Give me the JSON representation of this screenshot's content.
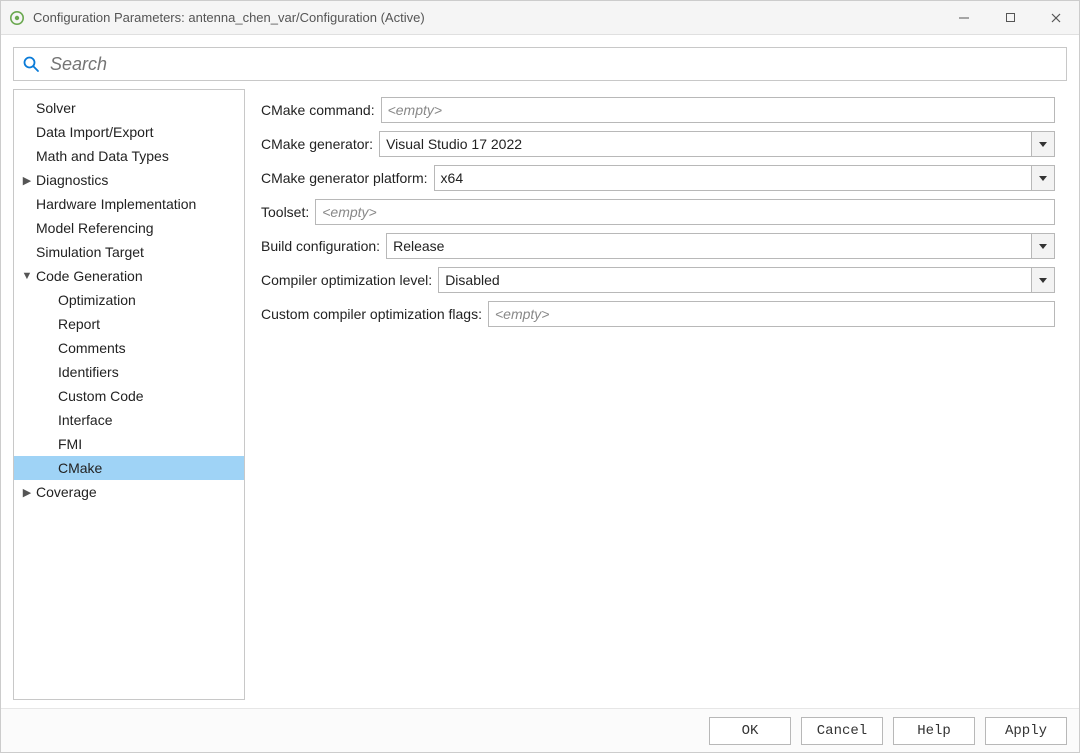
{
  "window": {
    "title": "Configuration Parameters: antenna_chen_var/Configuration (Active)"
  },
  "search": {
    "placeholder": "Search"
  },
  "sidebar": {
    "items": [
      {
        "label": "Solver",
        "depth": 0,
        "expandable": false
      },
      {
        "label": "Data Import/Export",
        "depth": 0,
        "expandable": false
      },
      {
        "label": "Math and Data Types",
        "depth": 0,
        "expandable": false
      },
      {
        "label": "Diagnostics",
        "depth": 0,
        "expandable": true,
        "expanded": false
      },
      {
        "label": "Hardware Implementation",
        "depth": 0,
        "expandable": false
      },
      {
        "label": "Model Referencing",
        "depth": 0,
        "expandable": false
      },
      {
        "label": "Simulation Target",
        "depth": 0,
        "expandable": false
      },
      {
        "label": "Code Generation",
        "depth": 0,
        "expandable": true,
        "expanded": true
      },
      {
        "label": "Optimization",
        "depth": 1,
        "expandable": false
      },
      {
        "label": "Report",
        "depth": 1,
        "expandable": false
      },
      {
        "label": "Comments",
        "depth": 1,
        "expandable": false
      },
      {
        "label": "Identifiers",
        "depth": 1,
        "expandable": false
      },
      {
        "label": "Custom Code",
        "depth": 1,
        "expandable": false
      },
      {
        "label": "Interface",
        "depth": 1,
        "expandable": false
      },
      {
        "label": "FMI",
        "depth": 1,
        "expandable": false
      },
      {
        "label": "CMake",
        "depth": 1,
        "expandable": false,
        "selected": true
      },
      {
        "label": "Coverage",
        "depth": 0,
        "expandable": true,
        "expanded": false
      }
    ]
  },
  "form": {
    "empty_placeholder": "<empty>",
    "rows": [
      {
        "label": "CMake command:",
        "type": "text",
        "value": ""
      },
      {
        "label": "CMake generator:",
        "type": "combo",
        "value": "Visual Studio 17 2022"
      },
      {
        "label": "CMake generator platform:",
        "type": "combo",
        "value": "x64"
      },
      {
        "label": "Toolset:",
        "type": "text",
        "value": ""
      },
      {
        "label": "Build configuration:",
        "type": "combo",
        "value": "Release"
      },
      {
        "label": "Compiler optimization level:",
        "type": "combo",
        "value": "Disabled"
      },
      {
        "label": "Custom compiler optimization flags:",
        "type": "text",
        "value": ""
      }
    ]
  },
  "buttons": {
    "ok": "OK",
    "cancel": "Cancel",
    "help": "Help",
    "apply": "Apply"
  }
}
